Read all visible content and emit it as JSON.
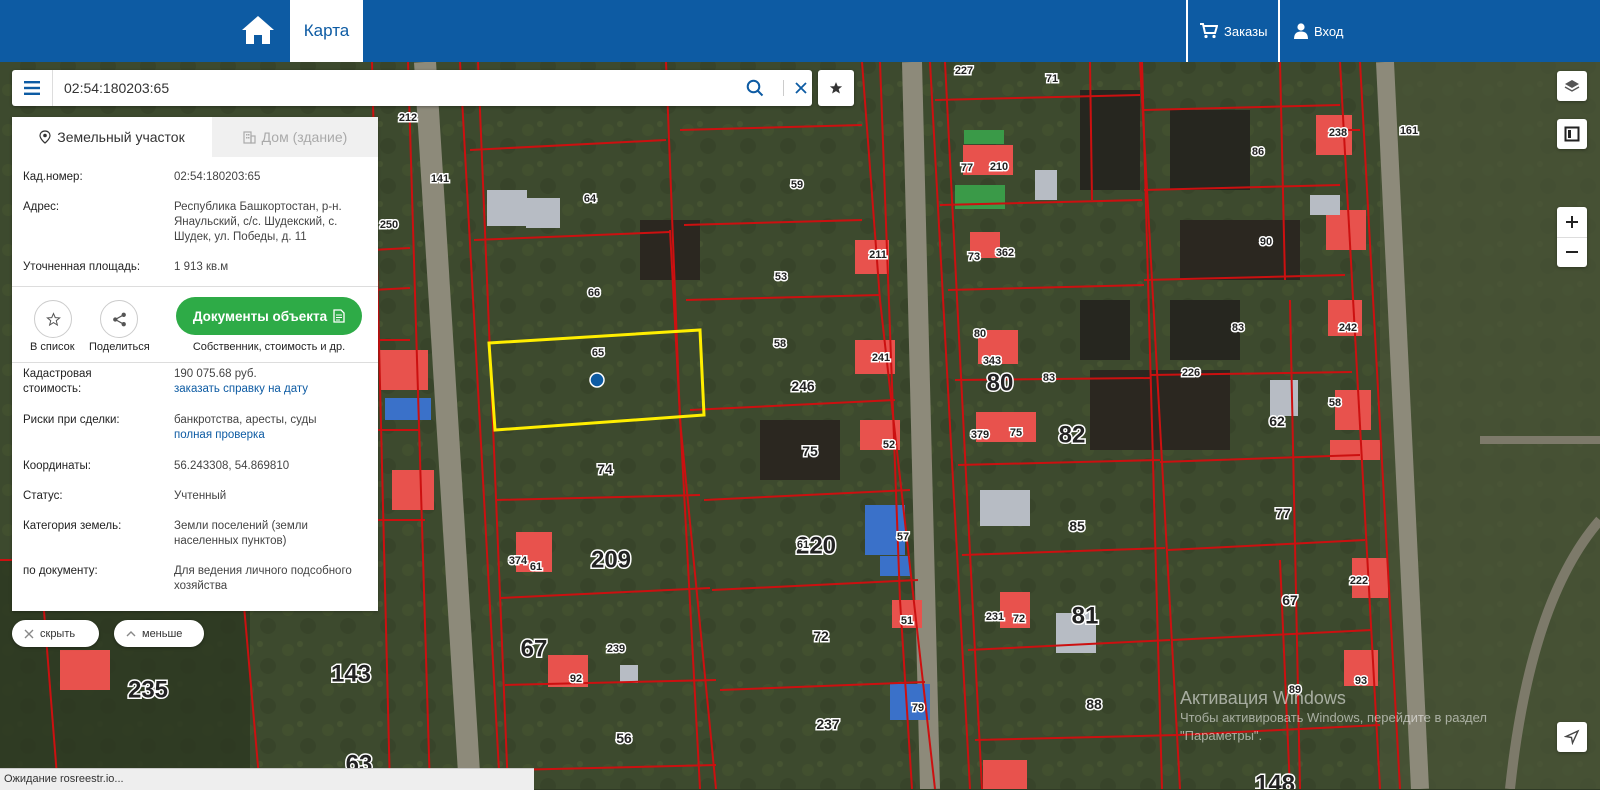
{
  "header": {
    "tab_map": "Карта",
    "orders": "Заказы",
    "login": "Вход"
  },
  "search": {
    "value": "02:54:180203:65"
  },
  "panel": {
    "tab_land": "Земельный участок",
    "tab_building": "Дом (здание)",
    "fields": {
      "cad_label": "Кад.номер:",
      "cad_value": "02:54:180203:65",
      "address_label": "Адрес:",
      "address_value": "Республика Башкортостан, р-н. Янаульский, с/с. Шудекский, с. Шудек, ул. Победы, д. 11",
      "area_label": "Уточненная площадь:",
      "area_value": "1 913 кв.м",
      "cost_label": "Кадастровая стоимость:",
      "cost_value": "190 075.68 руб.",
      "cost_link": "заказать справку на дату",
      "risks_label": "Риски при сделки:",
      "risks_value": "банкротства, аресты, суды",
      "risks_link": "полная проверка",
      "coords_label": "Координаты:",
      "coords_value": "56.243308, 54.869810",
      "status_label": "Статус:",
      "status_value": "Учтенный",
      "category_label": "Категория земель:",
      "category_value": "Земли поселений (земли населенных пунктов)",
      "doc_label": "по документу:",
      "doc_value": "Для ведения личного подсобного хозяйства"
    },
    "actions": {
      "to_list": "В список",
      "share": "Поделиться",
      "docs": "Документы объекта",
      "docs_sub": "Собственник, стоимость и др."
    }
  },
  "pills": {
    "hide": "скрыть",
    "less": "меньше"
  },
  "status_bar": "Ожидание rosreestr.io...",
  "watermark": {
    "title": "Активация Windows",
    "line1": "Чтобы активировать Windows, перейдите в раздел",
    "line2": "\"Параметры\"."
  },
  "map": {
    "selection_color": "#ffee00",
    "boundary_color": "#cc1010",
    "selected_marker_color": "#0d5ba3",
    "parcel_labels": [
      "227",
      "71",
      "212",
      "64",
      "59",
      "86",
      "238",
      "161",
      "77",
      "210",
      "141",
      "250",
      "211",
      "73",
      "362",
      "90",
      "53",
      "66",
      "58",
      "241",
      "80",
      "83",
      "242",
      "65",
      "343",
      "80",
      "83",
      "226",
      "58",
      "246",
      "52",
      "75",
      "379",
      "75",
      "82",
      "62",
      "74",
      "85",
      "77",
      "220",
      "57",
      "61",
      "374",
      "61",
      "209",
      "222",
      "51",
      "72",
      "231",
      "72",
      "81",
      "67",
      "67",
      "239",
      "92",
      "143",
      "235",
      "93",
      "63",
      "56",
      "237",
      "79",
      "88",
      "89",
      "148"
    ]
  }
}
